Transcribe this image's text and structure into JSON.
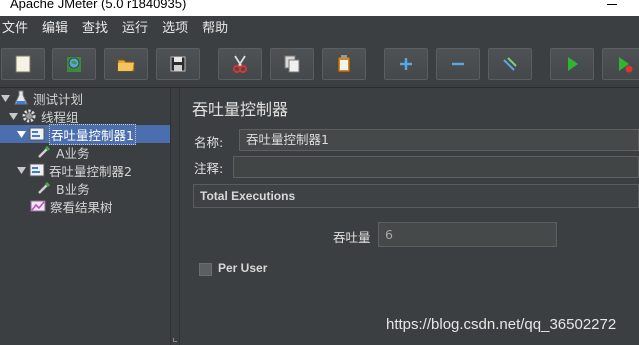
{
  "window": {
    "title": "Apache JMeter (5.0 r1840935)"
  },
  "menubar": {
    "items": [
      "文件",
      "编辑",
      "查找",
      "运行",
      "选项",
      "帮助"
    ]
  },
  "toolbar": {
    "buttons": [
      {
        "name": "new-icon"
      },
      {
        "name": "templates-icon"
      },
      {
        "name": "open-icon"
      },
      {
        "name": "save-icon"
      },
      {
        "name": "cut-icon"
      },
      {
        "name": "copy-icon"
      },
      {
        "name": "paste-icon"
      },
      {
        "name": "expand-icon"
      },
      {
        "name": "collapse-icon"
      },
      {
        "name": "toggle-icon"
      },
      {
        "name": "start-icon"
      },
      {
        "name": "start-no-pauses-icon"
      }
    ]
  },
  "tree": {
    "items": [
      {
        "label": "测试计划"
      },
      {
        "label": "线程组"
      },
      {
        "label": "吞吐量控制器1"
      },
      {
        "label": "A业务"
      },
      {
        "label": "吞吐量控制器2"
      },
      {
        "label": "B业务"
      },
      {
        "label": "察看结果树"
      }
    ]
  },
  "panel": {
    "title": "吞吐量控制器",
    "name_label": "名称:",
    "name_value": "吞吐量控制器1",
    "comment_label": "注释:",
    "comment_value": "",
    "mode_select": "Total Executions",
    "throughput_label": "吞吐量",
    "throughput_value": "6",
    "per_user_label": "Per User",
    "per_user_checked": false
  },
  "watermark": "https://blog.csdn.net/qq_36502272",
  "colors": {
    "selection": "#4b6eaf",
    "background": "#3c3f41"
  }
}
